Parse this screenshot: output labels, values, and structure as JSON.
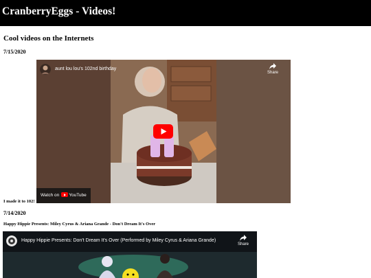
{
  "site": {
    "title": "CranberryEggs - Videos!"
  },
  "main": {
    "section_title": "Cool videos on the Internets",
    "posts": [
      {
        "date": "7/15/2020",
        "video_title": "aunt lou lou's 102nd birthday",
        "share_label": "Share",
        "watch_on_label": "Watch on",
        "youtube_label": "YouTube",
        "caption": "I made it to 102!"
      },
      {
        "date": "7/14/2020",
        "heading": "Happy Hippie Presents: Miley Cyrus & Ariana Grande - Don't Dream It's Over",
        "video_title": "Happy Hippie Presents: Don't Dream It's Over (Performed by Miley Cyrus & Ariana Grande)",
        "share_label": "Share"
      }
    ]
  },
  "colors": {
    "header_bg": "#000000",
    "youtube_red": "#ff0000"
  }
}
